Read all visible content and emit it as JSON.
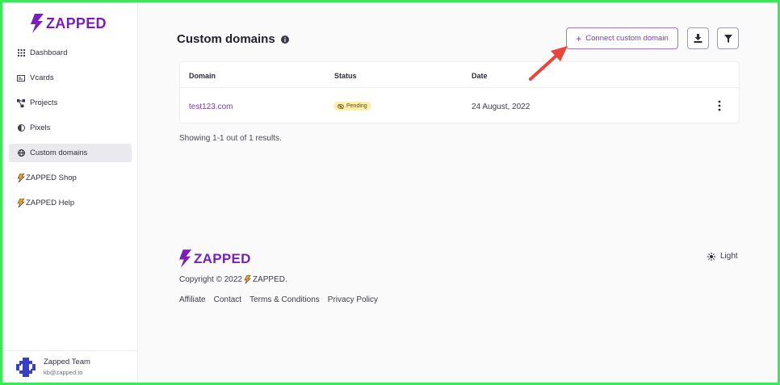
{
  "brand": {
    "name": "ZAPPED",
    "color": "#7a20b8",
    "accent": "#f2a81d"
  },
  "sidebar": {
    "items": [
      {
        "label": "Dashboard",
        "icon": "grid-icon"
      },
      {
        "label": "Vcards",
        "icon": "id-card-icon"
      },
      {
        "label": "Projects",
        "icon": "project-nodes-icon"
      },
      {
        "label": "Pixels",
        "icon": "half-circle-icon"
      },
      {
        "label": "Custom domains",
        "icon": "globe-icon",
        "active": true
      },
      {
        "label": "ZAPPED Shop",
        "icon": "bolt-icon"
      },
      {
        "label": "ZAPPED Help",
        "icon": "bolt-icon"
      }
    ],
    "user": {
      "name": "Zapped Team",
      "email": "kb@zapped.to"
    }
  },
  "main": {
    "title": "Custom domains",
    "connect_label": "Connect custom domain",
    "table": {
      "headers": [
        "Domain",
        "Status",
        "Date"
      ],
      "rows": [
        {
          "domain": "test123.com",
          "status": "Pending",
          "date": "24 August, 2022"
        }
      ]
    },
    "results_text": "Showing 1-1 out of 1 results."
  },
  "footer": {
    "copyright_prefix": "Copyright © 2022",
    "copyright_brand": "ZAPPED.",
    "links": [
      "Affiliate",
      "Contact",
      "Terms & Conditions",
      "Privacy Policy"
    ],
    "theme_label": "Light"
  },
  "colors": {
    "frame": "#3be85a",
    "pending_bg": "#fcefb1",
    "arrow": "#e8453c"
  }
}
